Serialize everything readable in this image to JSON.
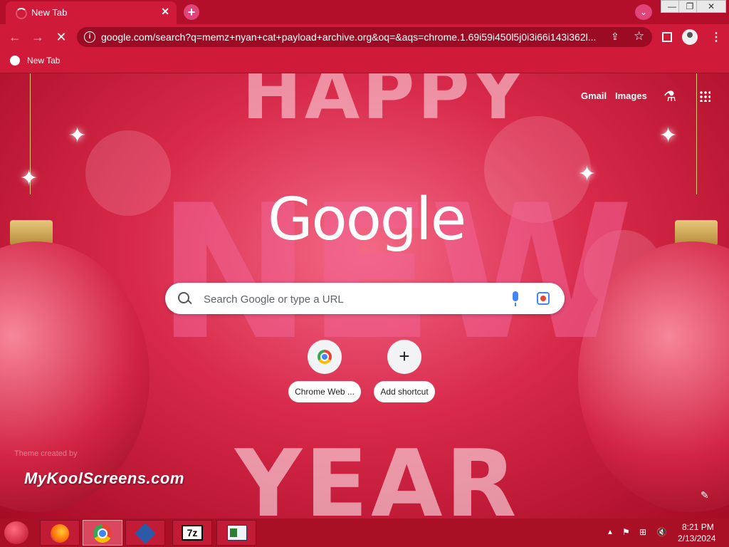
{
  "tab": {
    "title": "New Tab",
    "close": "✕"
  },
  "window": {
    "min": "—",
    "max": "❐",
    "close": "✕"
  },
  "toolbar": {
    "url": "google.com/search?q=memz+nyan+cat+payload+archive.org&oq=&aqs=chrome.1.69i59i450l5j0i3i66i143i362l..."
  },
  "bookmarks": [
    {
      "label": "New Tab"
    }
  ],
  "page": {
    "links": {
      "gmail": "Gmail",
      "images": "Images"
    },
    "logo": "Google",
    "search": {
      "placeholder": "Search Google or type a URL"
    },
    "shortcuts": [
      {
        "label": "Chrome Web ..."
      },
      {
        "label": "Add shortcut",
        "icon": "+"
      }
    ],
    "theme_credit": "Theme created by",
    "watermark": "MyKoolScreens.com",
    "decoration": {
      "happy": "HAPPY",
      "new": "NEW",
      "year": "YEAR"
    }
  },
  "taskbar": {
    "apps": [
      {
        "name": "Firefox"
      },
      {
        "name": "Google Chrome",
        "active": true
      },
      {
        "name": "VirtualBox"
      },
      {
        "name": "7-Zip",
        "label": "7z"
      },
      {
        "name": "Application"
      }
    ],
    "clock": {
      "time": "8:21 PM",
      "date": "2/13/2024"
    }
  },
  "colors": {
    "chrome_red": "#d01a3a",
    "tabstrip_red": "#b40f2a",
    "taskbar_red": "#a90f25"
  }
}
